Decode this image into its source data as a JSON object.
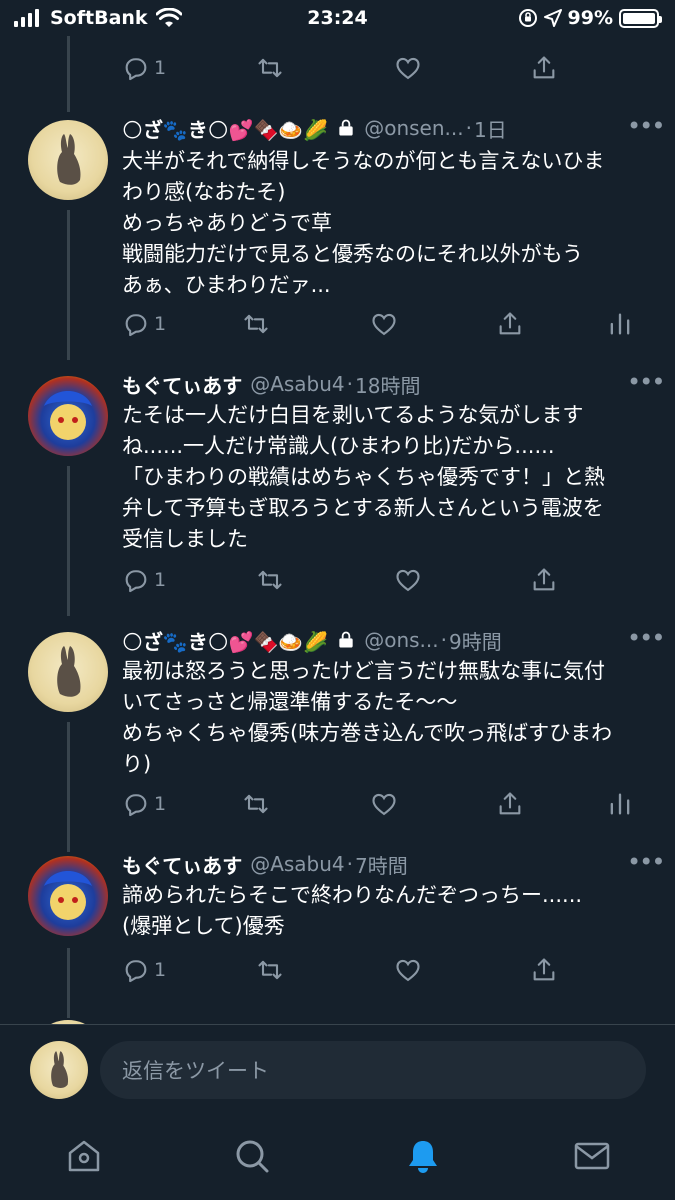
{
  "status_bar": {
    "carrier": "SoftBank",
    "time": "23:24",
    "battery_percent": "99%",
    "battery_level": 0.99
  },
  "top_partial_actions": {
    "reply_count": "1"
  },
  "tweets": [
    {
      "display_name": "🌕ざ🐾き🌕💕🍫🍛🌽",
      "protected": true,
      "handle": "@onsen...",
      "time": "1日",
      "text": "大半がそれで納得しそうなのが何とも言えないひま\nわり感(なおたそ)\nめっちゃありどうで草\n戦闘能力だけで見ると優秀なのにそれ以外がもう\nあぁ、ひまわりだァ...",
      "reply_count": "1"
    },
    {
      "display_name": "もぐてぃあす",
      "protected": false,
      "handle": "@Asabu4",
      "time": "18時間",
      "text": "たそは一人だけ白目を剥いてるような気がします\nね......一人だけ常識人(ひまわり比)だから......\n「ひまわりの戦績はめちゃくちゃ優秀です！」と熱\n弁して予算もぎ取ろうとする新人さんという電波を\n受信しました",
      "reply_count": "1"
    },
    {
      "display_name": "🌕ざ🐾き🌕💕🍫🍛🌽",
      "protected": true,
      "handle": "@ons...",
      "time": "9時間",
      "text": "最初は怒ろうと思ったけど言うだけ無駄な事に気付\nいてさっさと帰還準備するたそ〜〜\nめちゃくちゃ優秀(味方巻き込んで吹っ飛ばすひまわ\nり)",
      "reply_count": "1"
    },
    {
      "display_name": "もぐてぃあす",
      "protected": false,
      "handle": "@Asabu4",
      "time": "7時間",
      "text": "諦められたらそこで終わりなんだぞつっちー......\n(爆弾として)優秀",
      "reply_count": "1"
    }
  ],
  "reply_composer": {
    "placeholder": "返信をツイート"
  },
  "tabs": [
    "home-icon",
    "search-icon",
    "notifications-icon",
    "messages-icon"
  ],
  "colors": {
    "background": "#15202b",
    "secondary_text": "#8b98a5",
    "accent": "#1d9bf0"
  }
}
